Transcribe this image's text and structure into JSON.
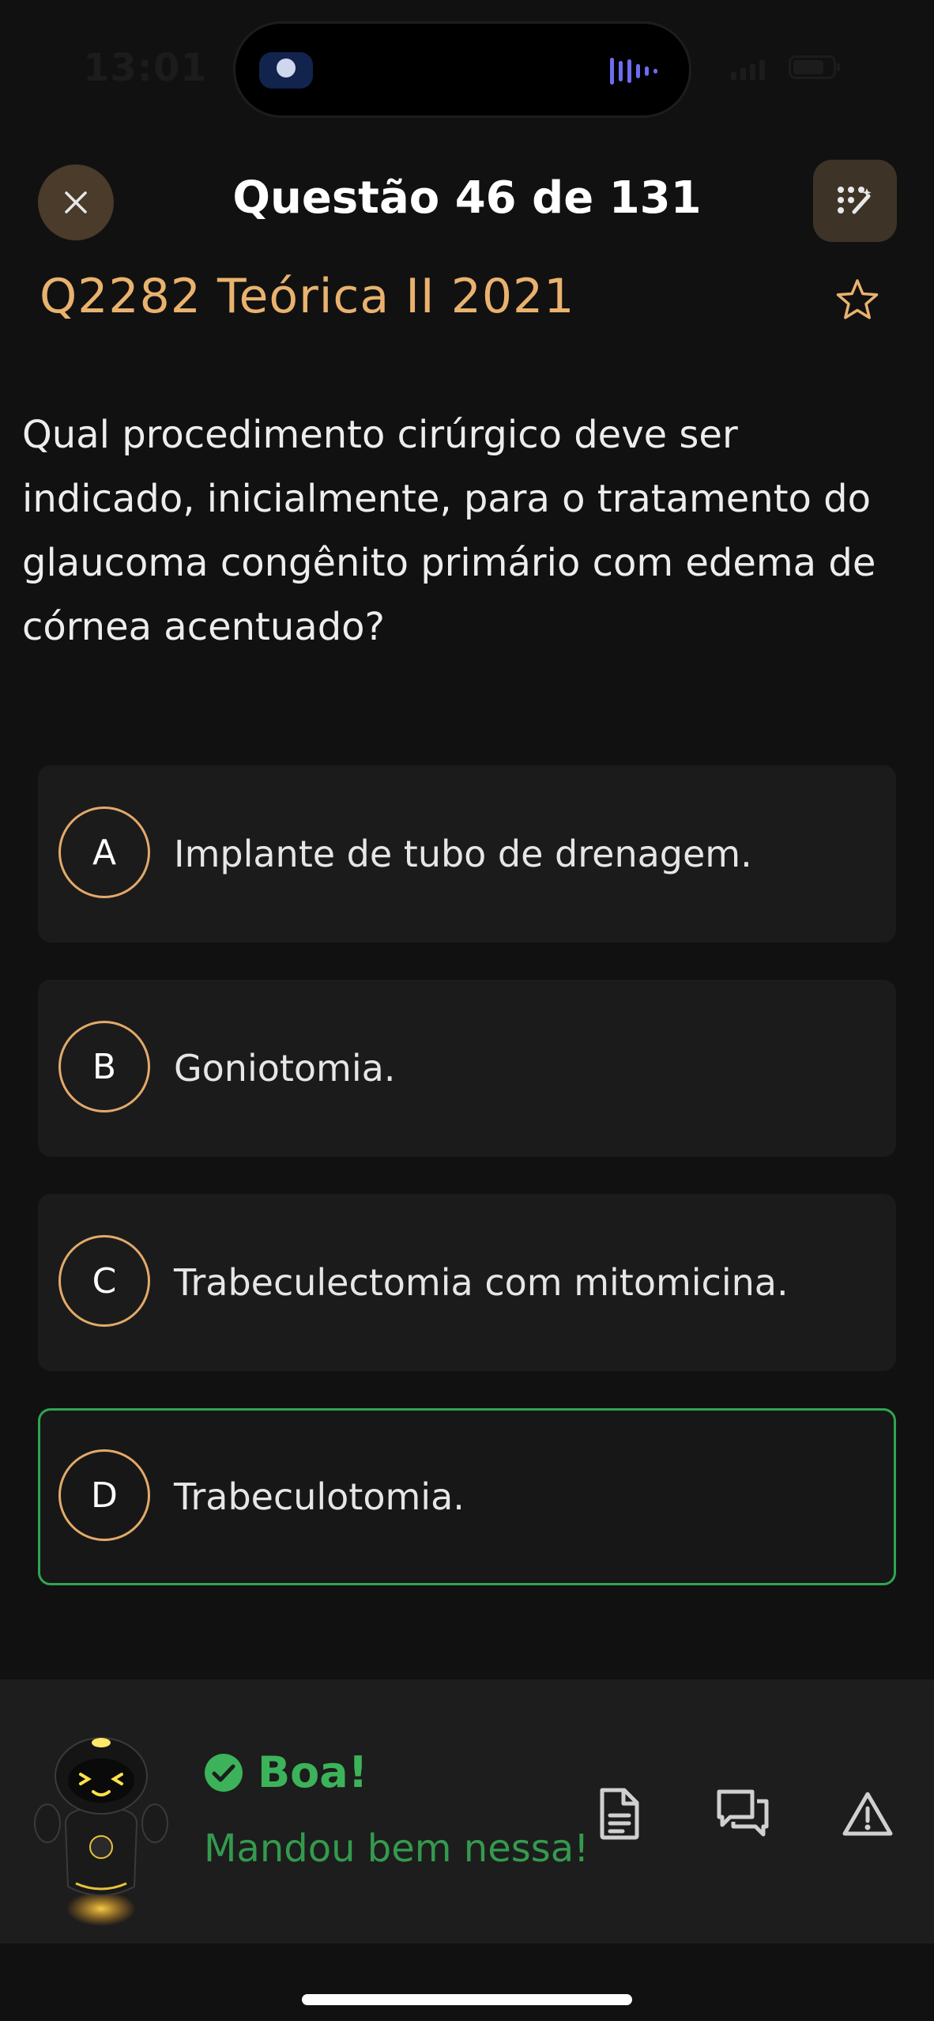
{
  "status_bar": {
    "time": "13:01"
  },
  "header": {
    "title": "Questão 46 de 131",
    "close_icon": "close-icon",
    "tools_icon": "grid-wand-icon"
  },
  "question": {
    "exam_label": "Q2282 Teórica II 2021",
    "text": "Qual procedimento cirúrgico deve ser indicado, inicialmente, para o tratamento do glaucoma congênito primário com edema de córnea acentuado?"
  },
  "options": [
    {
      "letter": "A",
      "text": "Implante de tubo de drenagem."
    },
    {
      "letter": "B",
      "text": "Goniotomia."
    },
    {
      "letter": "C",
      "text": "Trabeculectomia com mitomicina."
    },
    {
      "letter": "D",
      "text": "Trabeculotomia.",
      "selected_correct": true
    }
  ],
  "feedback": {
    "title": "Boa!",
    "subtitle": "Mandou bem nessa!",
    "actions": [
      "document-icon",
      "comments-icon",
      "warning-icon"
    ]
  },
  "colors": {
    "accent": "#e9b26e",
    "success": "#3cb35a",
    "background": "#111111",
    "card": "#1b1b1b"
  }
}
